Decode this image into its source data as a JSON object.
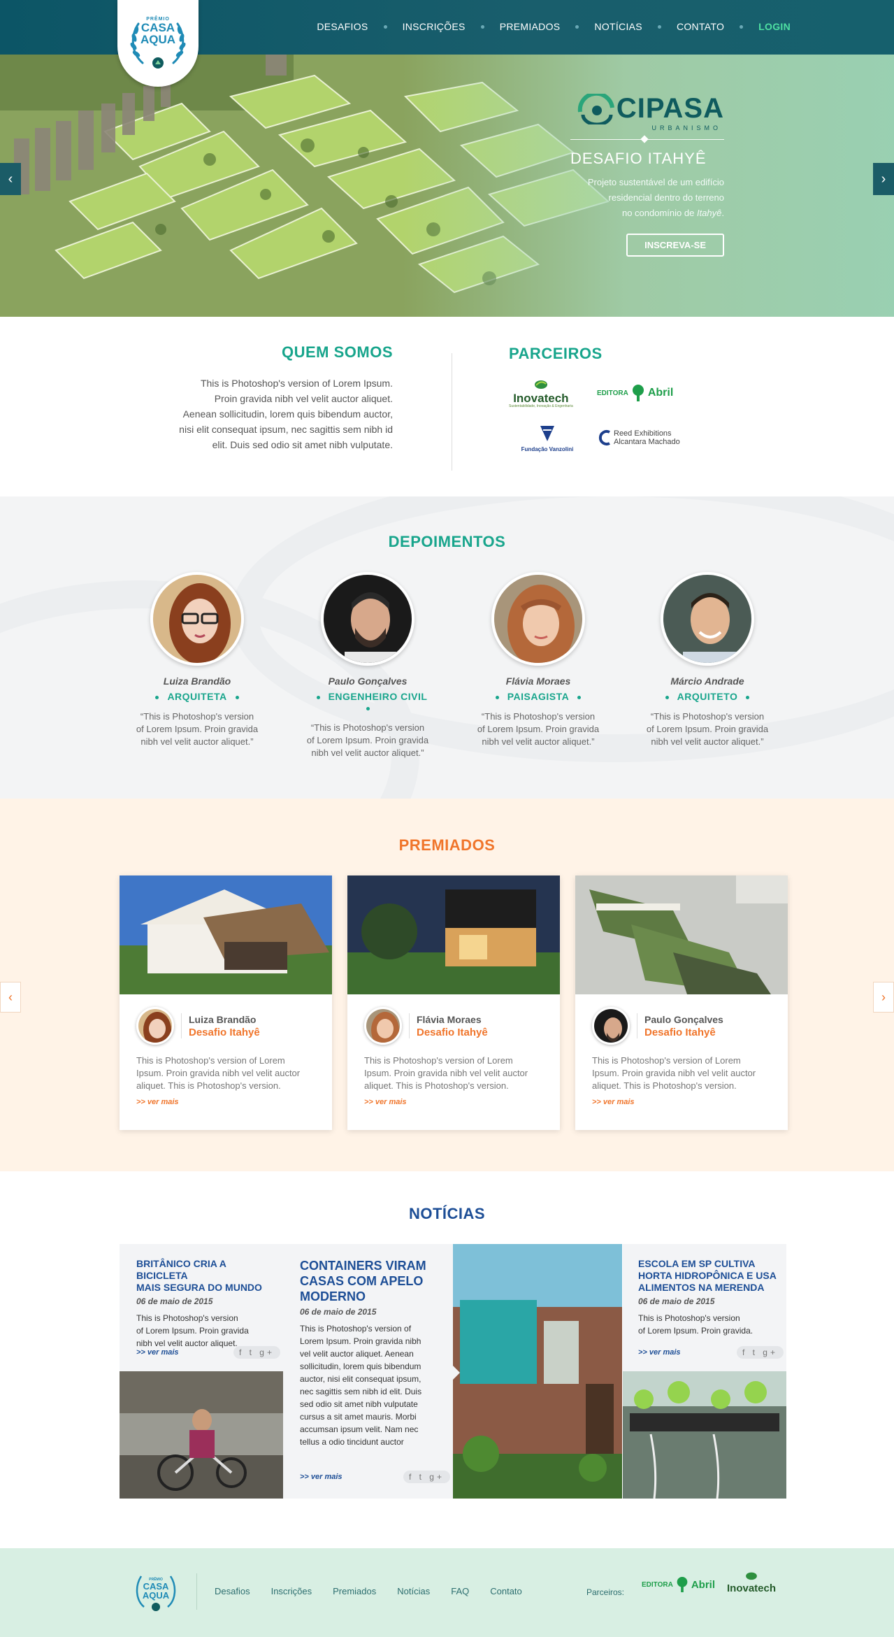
{
  "header": {
    "logo": {
      "small": "PRÊMIO",
      "line1": "CASA",
      "line2": "AQUA"
    },
    "nav": [
      {
        "label": "DESAFIOS"
      },
      {
        "label": "INSCRIÇÕES"
      },
      {
        "label": "PREMIADOS"
      },
      {
        "label": "NOTÍCIAS"
      },
      {
        "label": "CONTATO"
      }
    ],
    "login": "LOGIN"
  },
  "hero": {
    "brand": "CIPASA",
    "brand_sub": "URBANISMO",
    "title": "DESAFIO ITAHYÊ",
    "text_1": "Projeto sustentável de um edifício",
    "text_2": "residencial dentro do terreno",
    "text_3": "no condomínio de ",
    "text_italic": "Itahyê",
    "text_end": ".",
    "button": "INSCREVA-SE",
    "prev": "‹",
    "next": "›"
  },
  "about": {
    "title": "QUEM SOMOS",
    "line1": "This is Photoshop's version  of Lorem Ipsum.",
    "line2": "Proin gravida nibh vel velit auctor aliquet.",
    "line3": "Aenean sollicitudin, lorem quis bibendum auctor,",
    "line4": "nisi elit consequat ipsum, nec sagittis sem nibh id",
    "line5": "elit. Duis sed odio sit amet nibh vulputate."
  },
  "partners": {
    "title": "PARCEIROS",
    "inovatech": "Inovatech",
    "inovatech_sub": "Sustentabilidade, Inovação & Engenharia",
    "abril_prefix": "EDITORA",
    "abril": "Abril",
    "vanzolini": "Fundação Vanzolini",
    "reed_1": "Reed Exhibitions",
    "reed_2": "Alcantara Machado"
  },
  "testimonials": {
    "title": "DEPOIMENTOS",
    "people": [
      {
        "name": "Luiza Brandão",
        "role": "ARQUITETA",
        "q1": "This is Photoshop's version",
        "q2": "of Lorem Ipsum. Proin gravida",
        "q3": "nibh vel velit auctor aliquet."
      },
      {
        "name": "Paulo Gonçalves",
        "role": "ENGENHEIRO CIVIL",
        "q1": "This is Photoshop's version",
        "q2": "of Lorem Ipsum. Proin gravida",
        "q3": "nibh vel velit auctor aliquet."
      },
      {
        "name": "Flávia Moraes",
        "role": "PAISAGISTA",
        "q1": "This is Photoshop's version",
        "q2": "of Lorem Ipsum. Proin gravida",
        "q3": "nibh vel velit auctor aliquet."
      },
      {
        "name": "Márcio Andrade",
        "role": "ARQUITETO",
        "q1": "This is Photoshop's version",
        "q2": "of Lorem Ipsum. Proin gravida",
        "q3": "nibh vel velit auctor aliquet."
      }
    ]
  },
  "awards": {
    "title": "PREMIADOS",
    "prev": "‹",
    "next": "›",
    "cards": [
      {
        "name": "Luiza Brandão",
        "desafio": "Desafio Itahyê",
        "t1": "This is Photoshop's version  of Lorem",
        "t2": "Ipsum. Proin gravida nibh vel velit auctor",
        "t3": "aliquet. This is Photoshop's version.",
        "more": ">> ver mais"
      },
      {
        "name": "Flávia Moraes",
        "desafio": "Desafio Itahyê",
        "t1": "This is Photoshop's version  of Lorem",
        "t2": "Ipsum. Proin gravida nibh vel velit auctor",
        "t3": "aliquet. This is Photoshop's version.",
        "more": ">> ver mais"
      },
      {
        "name": "Paulo Gonçalves",
        "desafio": "Desafio Itahyê",
        "t1": "This is Photoshop's version  of Lorem",
        "t2": "Ipsum. Proin gravida nibh vel velit auctor",
        "t3": "aliquet. This is Photoshop's version.",
        "more": ">> ver mais"
      }
    ]
  },
  "news": {
    "title": "NOTÍCIAS",
    "items": [
      {
        "h1": "BRITÂNICO CRIA A BICICLETA",
        "h2": "MAIS SEGURA DO MUNDO",
        "h3": "",
        "date": "06 de maio de 2015",
        "p": [
          "This is Photoshop's version",
          "of Lorem Ipsum. Proin gravida",
          "nibh vel velit auctor aliquet."
        ],
        "more": ">> ver mais"
      },
      {
        "h1": "CONTAINERS VIRAM",
        "h2": "CASAS COM APELO",
        "h3": "MODERNO",
        "date": "06 de maio de 2015",
        "p": [
          "This is Photoshop's version  of",
          "Lorem Ipsum. Proin gravida nibh",
          "vel velit auctor aliquet. Aenean",
          "sollicitudin, lorem quis bibendum",
          "auctor, nisi elit consequat ipsum,",
          "nec sagittis sem nibh id elit. Duis",
          "sed odio sit amet nibh vulputate",
          "cursus a sit amet mauris. Morbi",
          "accumsan ipsum velit. Nam nec",
          "tellus a odio tincidunt auctor"
        ],
        "more": ">> ver mais"
      },
      {
        "h1": "ESCOLA EM SP CULTIVA",
        "h2": "HORTA HIDROPÔNICA E USA",
        "h3": "ALIMENTOS NA MERENDA",
        "date": "06 de maio de 2015",
        "p": [
          "This is Photoshop's version",
          "of Lorem Ipsum. Proin gravida."
        ],
        "more": ">> ver mais"
      }
    ],
    "share": "f t g+"
  },
  "footer": {
    "links": [
      "Desafios",
      "Inscrições",
      "Premiados",
      "Notícias",
      "FAQ",
      "Contato"
    ],
    "partners_label": "Parceiros:"
  },
  "colors": {
    "header": "#0f5968",
    "green_accent": "#18a58c",
    "orange_accent": "#f0752b",
    "news_blue": "#1d4e96",
    "login": "#4ee0a2",
    "footer_bg": "#d8efe3",
    "awards_bg": "#fff3e7"
  }
}
